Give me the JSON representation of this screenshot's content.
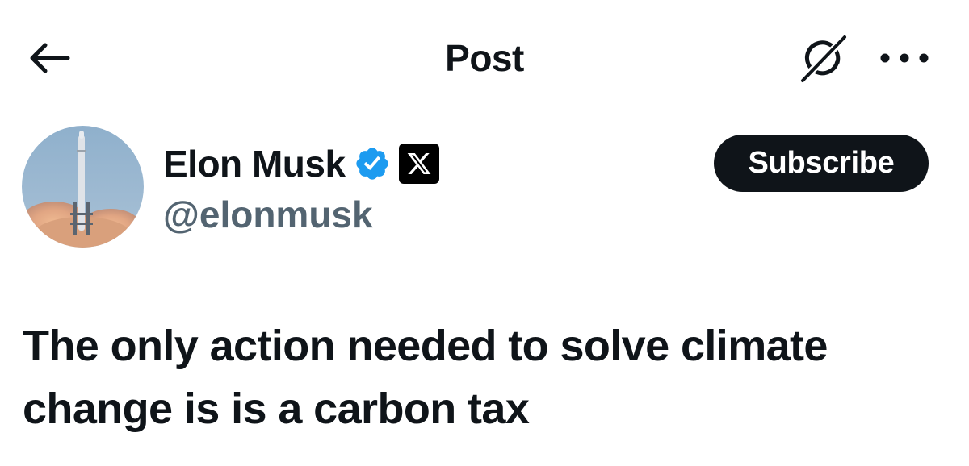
{
  "header": {
    "back_icon": "arrow-left-icon",
    "title": "Post",
    "grok_icon": "grok-slash-icon",
    "more_icon": "more-horizontal-icon"
  },
  "author": {
    "name": "Elon Musk",
    "handle": "@elonmusk",
    "verified_icon": "verified-badge-icon",
    "verified_color": "#1d9bf0",
    "affiliate_icon": "x-logo-icon",
    "avatar": "rocket-launch-avatar"
  },
  "actions": {
    "subscribe_label": "Subscribe"
  },
  "post": {
    "text": "The only action needed to solve climate change is is a carbon tax"
  },
  "colors": {
    "text_primary": "#0f1419",
    "text_secondary": "#536471",
    "button_bg": "#0f1419",
    "background": "#ffffff"
  }
}
